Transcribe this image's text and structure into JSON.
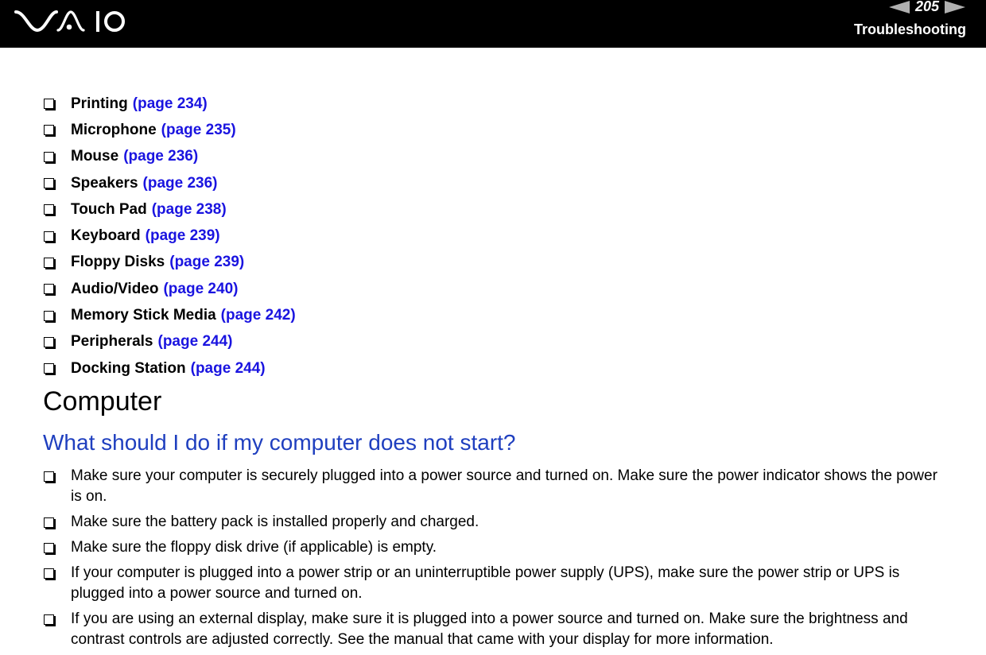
{
  "header": {
    "logo": "VAIO",
    "page_number": "205",
    "section_title": "Troubleshooting",
    "prev_icon": "triangle-left-icon",
    "next_icon": "triangle-right-icon"
  },
  "topics": [
    {
      "label": "Printing",
      "link": "(page 234)"
    },
    {
      "label": "Microphone",
      "link": "(page 235)"
    },
    {
      "label": "Mouse",
      "link": "(page 236)"
    },
    {
      "label": "Speakers",
      "link": "(page 236)"
    },
    {
      "label": "Touch Pad",
      "link": "(page 238)"
    },
    {
      "label": "Keyboard",
      "link": "(page 239)"
    },
    {
      "label": "Floppy Disks",
      "link": "(page 239)"
    },
    {
      "label": "Audio/Video",
      "link": "(page 240)"
    },
    {
      "label": "Memory Stick Media",
      "link": "(page 242)"
    },
    {
      "label": "Peripherals",
      "link": "(page 244)"
    },
    {
      "label": "Docking Station",
      "link": "(page 244)"
    }
  ],
  "section": {
    "title": "Computer",
    "question": "What should I do if my computer does not start?",
    "answers": [
      "Make sure your computer is securely plugged into a power source and turned on. Make sure the power indicator shows the power is on.",
      "Make sure the battery pack is installed properly and charged.",
      "Make sure the floppy disk drive (if applicable) is empty.",
      "If your computer is plugged into a power strip or an uninterruptible power supply (UPS), make sure the power strip or UPS is plugged into a power source and turned on.",
      "If you are using an external display, make sure it is plugged into a power source and turned on. Make sure the brightness and contrast controls are adjusted correctly. See the manual that came with your display for more information."
    ]
  },
  "colors": {
    "header_bg": "#000000",
    "link": "#1a14e0",
    "question": "#1f3fbf",
    "nav_arrow": "#b0b0b0"
  }
}
